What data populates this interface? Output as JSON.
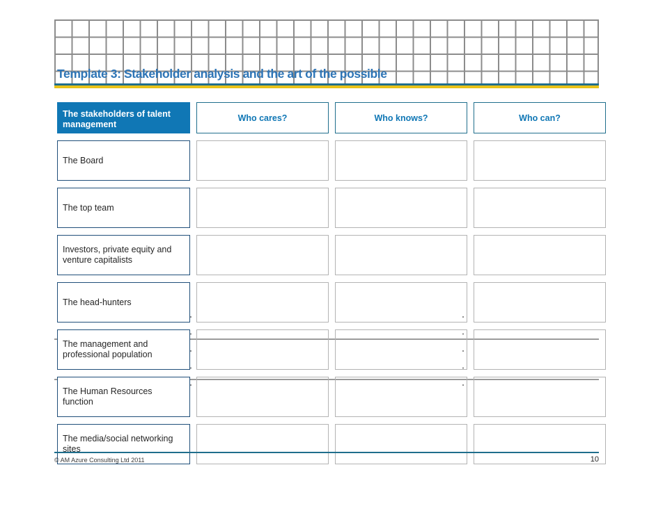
{
  "slide": {
    "title": "Template 3: Stakeholder analysis and the art of the possible",
    "accent_blue": "#2E75B6",
    "rule_blue": "#1F6E8C",
    "rule_gold": "#E8C219",
    "header_fill": "#1077B5",
    "label_border": "#1F4E79",
    "cell_border": "#b3b3b3",
    "grid_line": "#8c8c8c"
  },
  "matrix": {
    "row_header_label": "The stakeholders of talent management",
    "columns": [
      {
        "label": "Who cares?"
      },
      {
        "label": "Who knows?"
      },
      {
        "label": "Who can?"
      }
    ],
    "rows": [
      {
        "label": "The Board",
        "cells": [
          "",
          "",
          ""
        ]
      },
      {
        "label": "The top team",
        "cells": [
          "",
          "",
          ""
        ]
      },
      {
        "label": "Investors, private equity and venture capitalists",
        "cells": [
          "",
          "",
          ""
        ]
      },
      {
        "label": "The head-hunters",
        "cells": [
          "",
          "",
          ""
        ]
      },
      {
        "label": "The management and professional population",
        "cells": [
          "",
          "",
          ""
        ]
      },
      {
        "label": "The Human Resources function",
        "cells": [
          "",
          "",
          ""
        ]
      },
      {
        "label": "The media/social networking sites",
        "cells": [
          "",
          "",
          ""
        ]
      }
    ]
  },
  "footer": {
    "copyright": "© AM Azure Consulting Ltd 2011",
    "page_number": "10"
  }
}
